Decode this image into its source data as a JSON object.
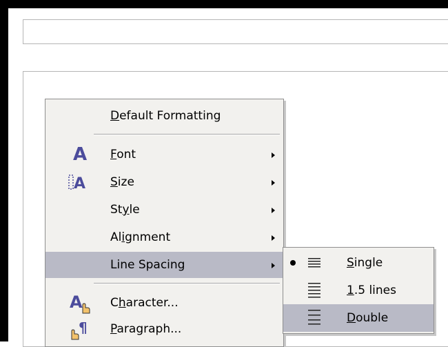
{
  "context_menu": {
    "items": [
      {
        "label": "Default Formatting",
        "mnemonic": "D",
        "rest": "efault Formatting",
        "has_submenu": false
      },
      {
        "label": "Font",
        "mnemonic": "F",
        "rest": "ont",
        "icon": "font-icon",
        "has_submenu": true
      },
      {
        "label": "Size",
        "mnemonic": "S",
        "rest": "ize",
        "icon": "font-size-icon",
        "has_submenu": true
      },
      {
        "label": "Style",
        "pre": "St",
        "mnemonic": "y",
        "rest": "le",
        "has_submenu": true
      },
      {
        "label": "Alignment",
        "pre": "Al",
        "mnemonic": "i",
        "rest": "gnment",
        "has_submenu": true
      },
      {
        "label": "Line Spacing",
        "has_submenu": true,
        "highlighted": true
      },
      {
        "label": "Character...",
        "pre": "C",
        "mnemonic": "h",
        "rest": "aracter...",
        "icon": "character-icon",
        "has_submenu": false
      },
      {
        "label": "Paragraph...",
        "mnemonic": "P",
        "rest": "aragraph...",
        "icon": "paragraph-icon",
        "has_submenu": false
      }
    ]
  },
  "line_spacing_submenu": {
    "items": [
      {
        "label": "Single",
        "mnemonic": "S",
        "rest": "ingle",
        "selected": true
      },
      {
        "label": "1.5 lines",
        "mnemonic": "1",
        "rest": ".5 lines",
        "selected": false
      },
      {
        "label": "Double",
        "mnemonic": "D",
        "rest": "ouble",
        "selected": false,
        "highlighted": true
      }
    ]
  },
  "colors": {
    "menu_bg": "#f2f1ee",
    "highlight": "#b9bac6",
    "icon_purple": "#4c4c9c"
  }
}
